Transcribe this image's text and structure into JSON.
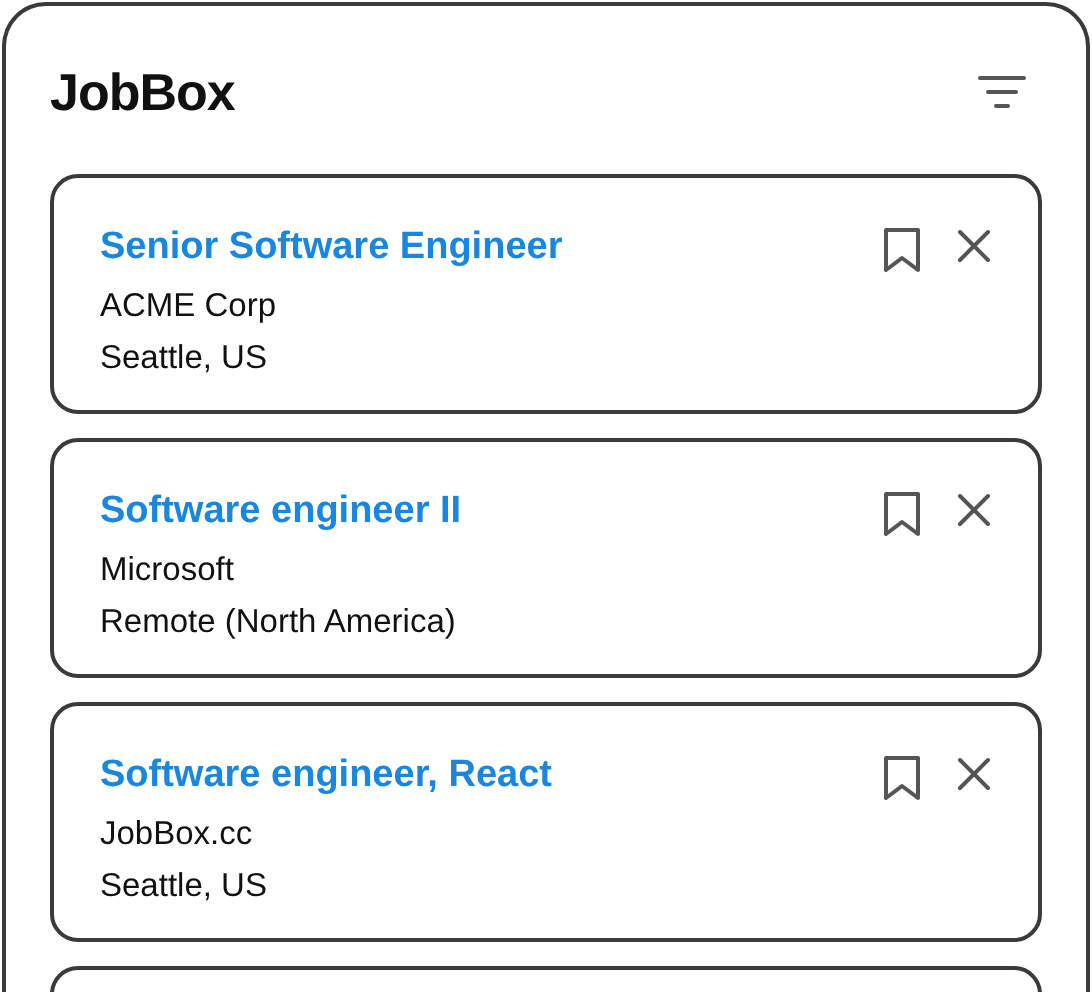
{
  "app": {
    "title": "JobBox"
  },
  "jobs": [
    {
      "title": "Senior Software Engineer",
      "company": "ACME Corp",
      "location": "Seattle, US"
    },
    {
      "title": "Software engineer II",
      "company": "Microsoft",
      "location": "Remote (North America)"
    },
    {
      "title": "Software engineer, React",
      "company": "JobBox.cc",
      "location": "Seattle, US"
    }
  ]
}
